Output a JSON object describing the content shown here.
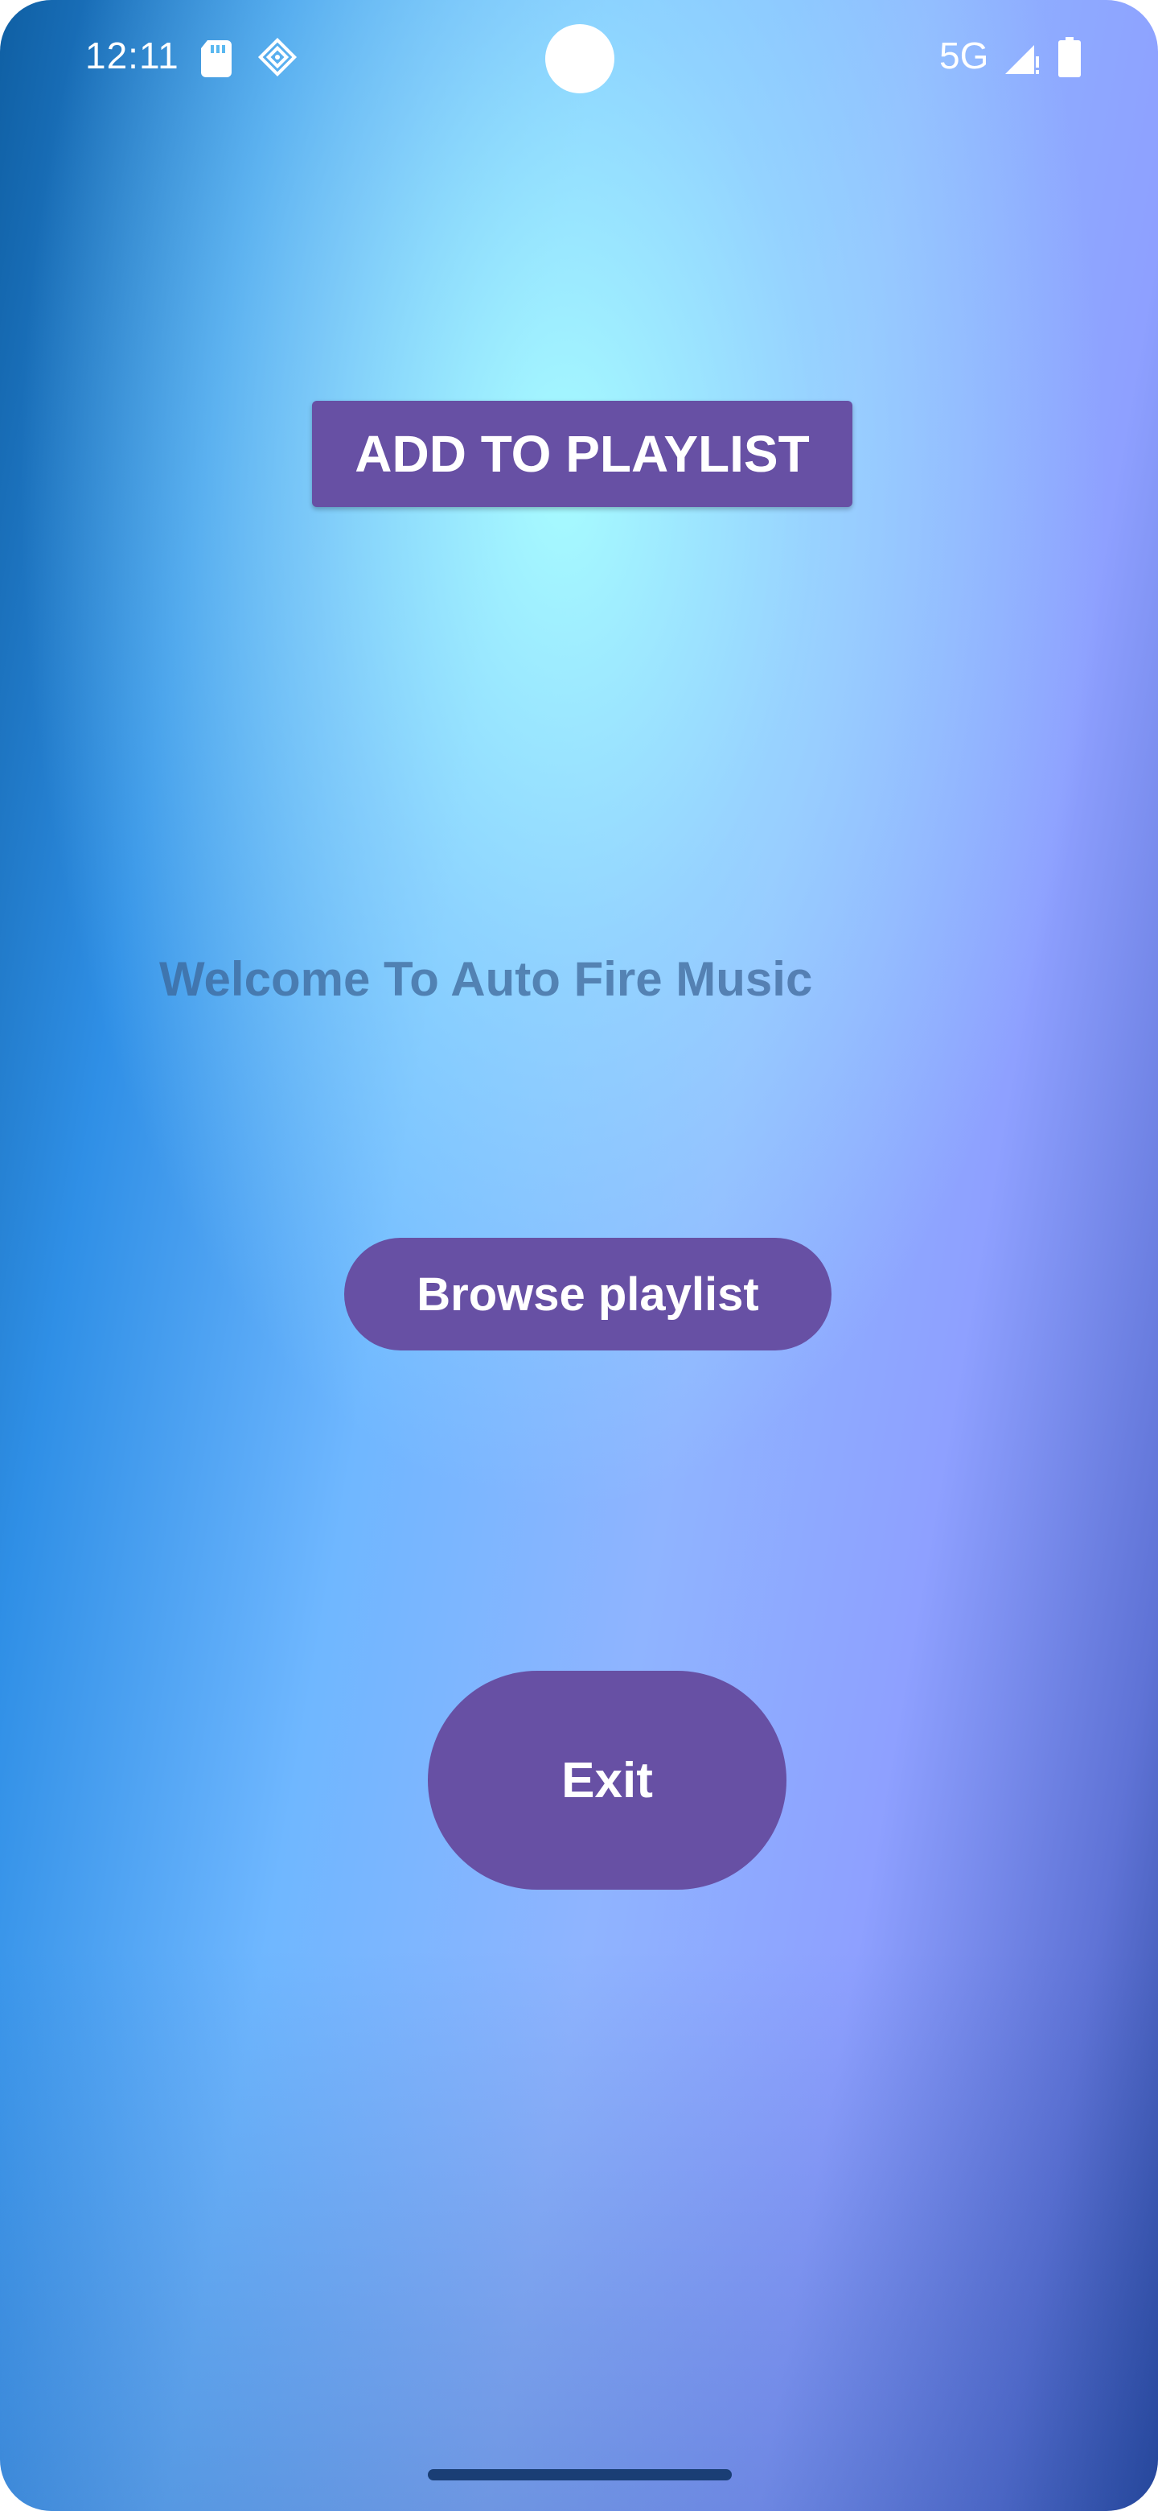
{
  "status_bar": {
    "time": "12:11",
    "network": "5G",
    "icons": [
      "sd-card-icon",
      "nfc-icon",
      "signal-icon",
      "battery-icon"
    ]
  },
  "main": {
    "add_to_playlist_label": "ADD TO PLAYLIST",
    "welcome_text": "Welcome To Auto Fire Music",
    "browse_playlist_label": "Browse playlist",
    "exit_label": "Exit"
  },
  "colors": {
    "button_primary": "#6750a4",
    "button_text": "#ffffff",
    "welcome_text": "#3c6496"
  }
}
